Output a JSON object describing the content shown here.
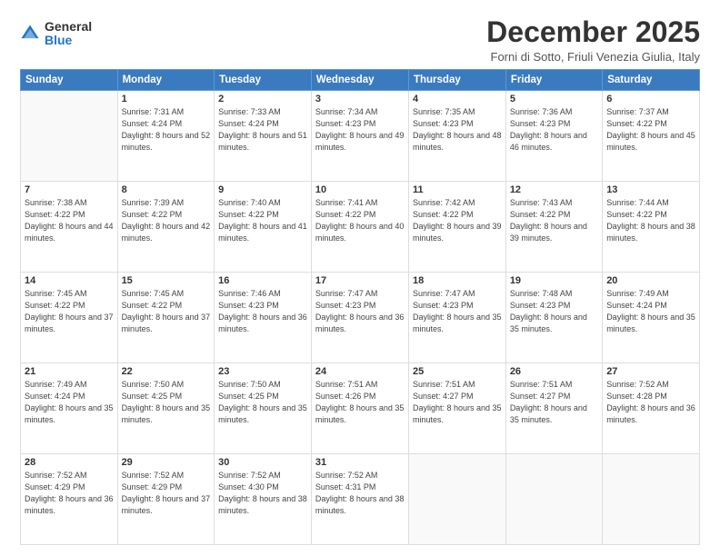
{
  "header": {
    "logo": {
      "general": "General",
      "blue": "Blue"
    },
    "title": "December 2025",
    "location": "Forni di Sotto, Friuli Venezia Giulia, Italy"
  },
  "days_header": [
    "Sunday",
    "Monday",
    "Tuesday",
    "Wednesday",
    "Thursday",
    "Friday",
    "Saturday"
  ],
  "weeks": [
    [
      {
        "day": "",
        "sunrise": "",
        "sunset": "",
        "daylight": ""
      },
      {
        "day": "1",
        "sunrise": "Sunrise: 7:31 AM",
        "sunset": "Sunset: 4:24 PM",
        "daylight": "Daylight: 8 hours and 52 minutes."
      },
      {
        "day": "2",
        "sunrise": "Sunrise: 7:33 AM",
        "sunset": "Sunset: 4:24 PM",
        "daylight": "Daylight: 8 hours and 51 minutes."
      },
      {
        "day": "3",
        "sunrise": "Sunrise: 7:34 AM",
        "sunset": "Sunset: 4:23 PM",
        "daylight": "Daylight: 8 hours and 49 minutes."
      },
      {
        "day": "4",
        "sunrise": "Sunrise: 7:35 AM",
        "sunset": "Sunset: 4:23 PM",
        "daylight": "Daylight: 8 hours and 48 minutes."
      },
      {
        "day": "5",
        "sunrise": "Sunrise: 7:36 AM",
        "sunset": "Sunset: 4:23 PM",
        "daylight": "Daylight: 8 hours and 46 minutes."
      },
      {
        "day": "6",
        "sunrise": "Sunrise: 7:37 AM",
        "sunset": "Sunset: 4:22 PM",
        "daylight": "Daylight: 8 hours and 45 minutes."
      }
    ],
    [
      {
        "day": "7",
        "sunrise": "Sunrise: 7:38 AM",
        "sunset": "Sunset: 4:22 PM",
        "daylight": "Daylight: 8 hours and 44 minutes."
      },
      {
        "day": "8",
        "sunrise": "Sunrise: 7:39 AM",
        "sunset": "Sunset: 4:22 PM",
        "daylight": "Daylight: 8 hours and 42 minutes."
      },
      {
        "day": "9",
        "sunrise": "Sunrise: 7:40 AM",
        "sunset": "Sunset: 4:22 PM",
        "daylight": "Daylight: 8 hours and 41 minutes."
      },
      {
        "day": "10",
        "sunrise": "Sunrise: 7:41 AM",
        "sunset": "Sunset: 4:22 PM",
        "daylight": "Daylight: 8 hours and 40 minutes."
      },
      {
        "day": "11",
        "sunrise": "Sunrise: 7:42 AM",
        "sunset": "Sunset: 4:22 PM",
        "daylight": "Daylight: 8 hours and 39 minutes."
      },
      {
        "day": "12",
        "sunrise": "Sunrise: 7:43 AM",
        "sunset": "Sunset: 4:22 PM",
        "daylight": "Daylight: 8 hours and 39 minutes."
      },
      {
        "day": "13",
        "sunrise": "Sunrise: 7:44 AM",
        "sunset": "Sunset: 4:22 PM",
        "daylight": "Daylight: 8 hours and 38 minutes."
      }
    ],
    [
      {
        "day": "14",
        "sunrise": "Sunrise: 7:45 AM",
        "sunset": "Sunset: 4:22 PM",
        "daylight": "Daylight: 8 hours and 37 minutes."
      },
      {
        "day": "15",
        "sunrise": "Sunrise: 7:45 AM",
        "sunset": "Sunset: 4:22 PM",
        "daylight": "Daylight: 8 hours and 37 minutes."
      },
      {
        "day": "16",
        "sunrise": "Sunrise: 7:46 AM",
        "sunset": "Sunset: 4:23 PM",
        "daylight": "Daylight: 8 hours and 36 minutes."
      },
      {
        "day": "17",
        "sunrise": "Sunrise: 7:47 AM",
        "sunset": "Sunset: 4:23 PM",
        "daylight": "Daylight: 8 hours and 36 minutes."
      },
      {
        "day": "18",
        "sunrise": "Sunrise: 7:47 AM",
        "sunset": "Sunset: 4:23 PM",
        "daylight": "Daylight: 8 hours and 35 minutes."
      },
      {
        "day": "19",
        "sunrise": "Sunrise: 7:48 AM",
        "sunset": "Sunset: 4:23 PM",
        "daylight": "Daylight: 8 hours and 35 minutes."
      },
      {
        "day": "20",
        "sunrise": "Sunrise: 7:49 AM",
        "sunset": "Sunset: 4:24 PM",
        "daylight": "Daylight: 8 hours and 35 minutes."
      }
    ],
    [
      {
        "day": "21",
        "sunrise": "Sunrise: 7:49 AM",
        "sunset": "Sunset: 4:24 PM",
        "daylight": "Daylight: 8 hours and 35 minutes."
      },
      {
        "day": "22",
        "sunrise": "Sunrise: 7:50 AM",
        "sunset": "Sunset: 4:25 PM",
        "daylight": "Daylight: 8 hours and 35 minutes."
      },
      {
        "day": "23",
        "sunrise": "Sunrise: 7:50 AM",
        "sunset": "Sunset: 4:25 PM",
        "daylight": "Daylight: 8 hours and 35 minutes."
      },
      {
        "day": "24",
        "sunrise": "Sunrise: 7:51 AM",
        "sunset": "Sunset: 4:26 PM",
        "daylight": "Daylight: 8 hours and 35 minutes."
      },
      {
        "day": "25",
        "sunrise": "Sunrise: 7:51 AM",
        "sunset": "Sunset: 4:27 PM",
        "daylight": "Daylight: 8 hours and 35 minutes."
      },
      {
        "day": "26",
        "sunrise": "Sunrise: 7:51 AM",
        "sunset": "Sunset: 4:27 PM",
        "daylight": "Daylight: 8 hours and 35 minutes."
      },
      {
        "day": "27",
        "sunrise": "Sunrise: 7:52 AM",
        "sunset": "Sunset: 4:28 PM",
        "daylight": "Daylight: 8 hours and 36 minutes."
      }
    ],
    [
      {
        "day": "28",
        "sunrise": "Sunrise: 7:52 AM",
        "sunset": "Sunset: 4:29 PM",
        "daylight": "Daylight: 8 hours and 36 minutes."
      },
      {
        "day": "29",
        "sunrise": "Sunrise: 7:52 AM",
        "sunset": "Sunset: 4:29 PM",
        "daylight": "Daylight: 8 hours and 37 minutes."
      },
      {
        "day": "30",
        "sunrise": "Sunrise: 7:52 AM",
        "sunset": "Sunset: 4:30 PM",
        "daylight": "Daylight: 8 hours and 38 minutes."
      },
      {
        "day": "31",
        "sunrise": "Sunrise: 7:52 AM",
        "sunset": "Sunset: 4:31 PM",
        "daylight": "Daylight: 8 hours and 38 minutes."
      },
      {
        "day": "",
        "sunrise": "",
        "sunset": "",
        "daylight": ""
      },
      {
        "day": "",
        "sunrise": "",
        "sunset": "",
        "daylight": ""
      },
      {
        "day": "",
        "sunrise": "",
        "sunset": "",
        "daylight": ""
      }
    ]
  ]
}
